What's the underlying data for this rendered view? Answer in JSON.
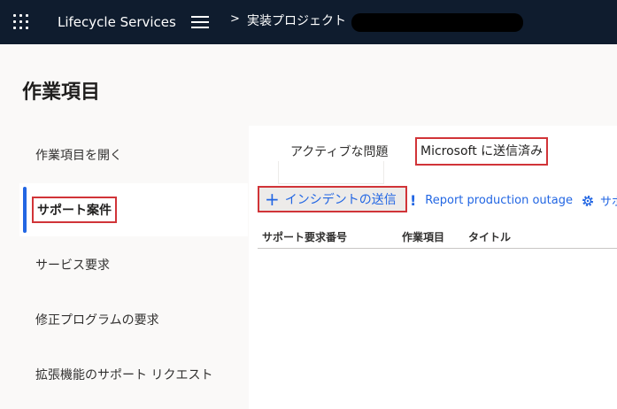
{
  "topbar": {
    "app_title": "Lifecycle Services",
    "breadcrumb_separator": ">",
    "project_name": "実装プロジェクト"
  },
  "page": {
    "title": "作業項目"
  },
  "left_nav": {
    "items": [
      {
        "label": "作業項目を開く",
        "selected": false
      },
      {
        "label": "サポート案件",
        "selected": true
      },
      {
        "label": "サービス要求",
        "selected": false
      },
      {
        "label": "修正プログラムの要求",
        "selected": false
      },
      {
        "label": "拡張機能のサポート リクエスト",
        "selected": false
      }
    ]
  },
  "tabs": [
    {
      "label": "アクティブな問題",
      "active": false
    },
    {
      "label": "Microsoft に送信済み",
      "active": true
    }
  ],
  "commands": {
    "submit_incident": "インシデントの送信",
    "report_outage": "Report production outage",
    "truncated": "サポ"
  },
  "table": {
    "columns": [
      "サポート要求番号",
      "作業項目",
      "タイトル"
    ]
  },
  "colors": {
    "topbar_bg": "#0f1c2e",
    "accent": "#2266e3",
    "highlight_border": "#d13438"
  }
}
